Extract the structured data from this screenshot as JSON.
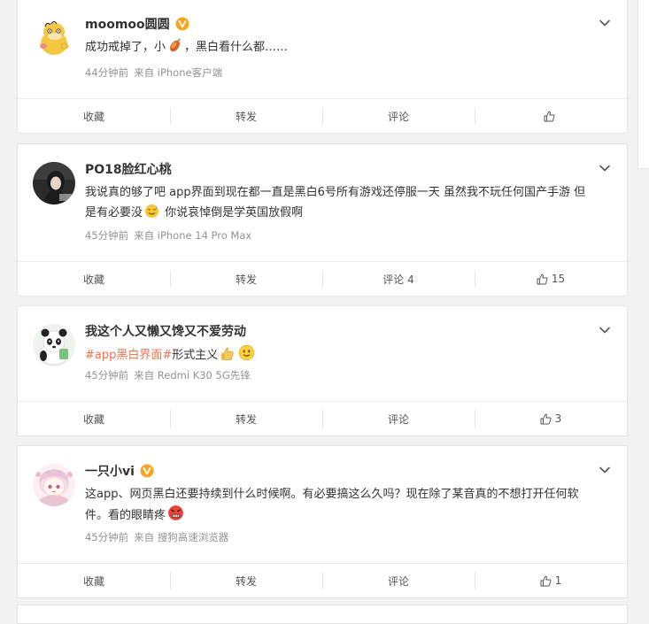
{
  "comments": [
    {
      "username": "moomoo圆圆",
      "verified": true,
      "text_before": "成功戒掉了，小",
      "emoji_mid": "sweet-potato-emoji",
      "text_after": "，黑白看什么都……",
      "time": "44分钟前",
      "source": "来自 iPhone客户端",
      "actions": {
        "collect": "收藏",
        "repost": "转发",
        "comment": "评论",
        "like_count": ""
      }
    },
    {
      "username": "PO18脸红心桃",
      "verified": false,
      "text_before": "我说真的够了吧 app界面到现在都一直是黑白6号所有游戏还停服一天 虽然我不玩任何国产手游 但是有必要没",
      "emoji_mid": "sweat-smile-emoji",
      "text_after": " 你说哀悼倒是学英国放假啊",
      "time": "45分钟前",
      "source": "来自 iPhone 14 Pro Max",
      "actions": {
        "collect": "收藏",
        "repost": "转发",
        "comment": "评论 4",
        "like_count": "15"
      }
    },
    {
      "username": "我这个人又懒又馋又不爱劳动",
      "verified": false,
      "hashtag": "#app黑白界面#",
      "text_after": "形式主义",
      "emoji_1": "thumbs-up-emoji",
      "emoji_2": "smile-emoji",
      "time": "45分钟前",
      "source": "来自 Redmi K30 5G先锋",
      "actions": {
        "collect": "收藏",
        "repost": "转发",
        "comment": "评论",
        "like_count": "3"
      }
    },
    {
      "username": "一只小vi",
      "verified": true,
      "text_before": "这app、网页黑白还要持续到什么时候啊。有必要搞这么久吗？现在除了某音真的不想打开任何软件。看的眼睛疼",
      "emoji_end": "angry-emoji",
      "time": "45分钟前",
      "source": "来自 搜狗高速浏览器",
      "actions": {
        "collect": "收藏",
        "repost": "转发",
        "comment": "评论",
        "like_count": "1"
      }
    }
  ],
  "colors": {
    "hashtag": "#eb7350",
    "verified_badge": "#f5a623",
    "meta_text": "#939393"
  }
}
